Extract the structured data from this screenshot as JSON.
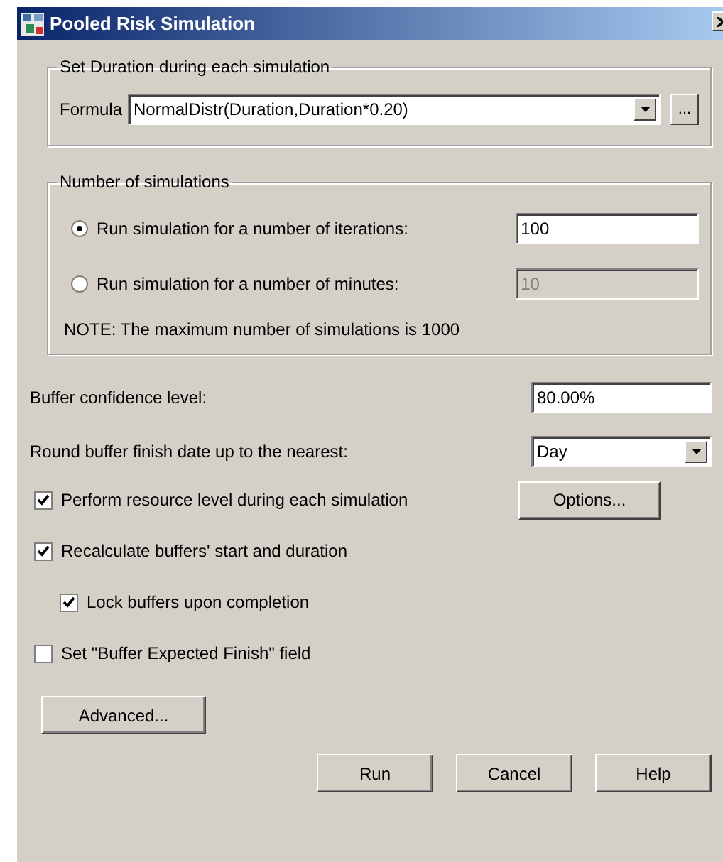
{
  "window": {
    "title": "Pooled Risk Simulation"
  },
  "duration_group": {
    "title": "Set Duration during each simulation",
    "formula_label": "Formula",
    "formula_value": "NormalDistr(Duration,Duration*0.20)",
    "browse_button": "..."
  },
  "simulations_group": {
    "title": "Number of simulations",
    "options": [
      {
        "label": "Run simulation for a number of iterations:",
        "selected": true,
        "value": "100",
        "disabled": false
      },
      {
        "label": "Run simulation for a number of minutes:",
        "selected": false,
        "value": "10",
        "disabled": true
      }
    ],
    "note": "NOTE: The maximum number of simulations is 1000"
  },
  "confidence": {
    "label": "Buffer confidence level:",
    "value": "80.00%"
  },
  "rounding": {
    "label": "Round buffer finish date up to the nearest:",
    "value": "Day"
  },
  "checkboxes": [
    {
      "label": "Perform resource level during each simulation",
      "checked": true,
      "indented": false,
      "button": "Options..."
    },
    {
      "label": "Recalculate buffers' start and duration",
      "checked": true,
      "indented": false
    },
    {
      "label": "Lock buffers upon completion",
      "checked": true,
      "indented": true
    },
    {
      "label": "Set \"Buffer Expected Finish\" field",
      "checked": false,
      "indented": false
    }
  ],
  "advanced_button": "Advanced...",
  "buttons": [
    "Run",
    "Cancel",
    "Help"
  ]
}
